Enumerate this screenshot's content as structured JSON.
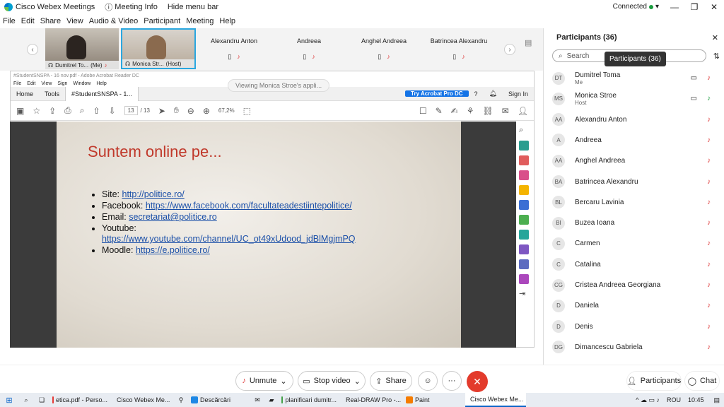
{
  "titlebar": {
    "app_title": "Cisco Webex Meetings",
    "meeting_info": "Meeting Info",
    "hide_menu": "Hide menu bar",
    "connected": "Connected"
  },
  "menu": [
    "File",
    "Edit",
    "Share",
    "View",
    "Audio & Video",
    "Participant",
    "Meeting",
    "Help"
  ],
  "video_strip": {
    "tiles": [
      {
        "name": "Dumitrel To...",
        "role": "(Me)"
      },
      {
        "name": "Monica Str...",
        "role": "(Host)"
      }
    ],
    "names": [
      "Alexandru Anton",
      "Andreea",
      "Anghel Andreea",
      "Batrincea Alexandru"
    ]
  },
  "shared": {
    "acrobat_title": "#StudentSNSPA - 16 nov.pdf - Adobe Acrobat Reader DC",
    "viewing": "Viewing Monica Stroe's appli...",
    "acrobat_menu": [
      "File",
      "Edit",
      "View",
      "Sign",
      "Window",
      "Help"
    ],
    "tabs": {
      "home": "Home",
      "tools": "Tools",
      "doc": "#StudentSNSPA - 1..."
    },
    "try_button": "Try Acrobat Pro DC",
    "sign_in": "Sign In",
    "page_current": "13",
    "page_total": "/ 13",
    "zoom": "67,2%",
    "slide": {
      "title": "Suntem online pe...",
      "items": [
        {
          "label": "Site: ",
          "link": "http://politice.ro/"
        },
        {
          "label": "Facebook: ",
          "link": "https://www.facebook.com/facultateadestiintepolitice/"
        },
        {
          "label": "Email: ",
          "link": "secretariat@politice.ro"
        },
        {
          "label": "Youtube:",
          "link": "https://www.youtube.com/channel/UC_ot49xUdood_jdBlMgjmPQ"
        },
        {
          "label": "Moodle: ",
          "link": "https://e.politice.ro/"
        }
      ]
    }
  },
  "participants": {
    "header": "Participants (36)",
    "search_placeholder": "Search",
    "tooltip": "Participants (36)",
    "list": [
      {
        "initials": "DT",
        "name": "Dumitrel Toma",
        "sub": "Me",
        "video": true,
        "mic": "off"
      },
      {
        "initials": "MS",
        "name": "Monica Stroe",
        "sub": "Host",
        "video": true,
        "mic": "on"
      },
      {
        "initials": "AA",
        "name": "Alexandru Anton",
        "sub": "",
        "mic": "off"
      },
      {
        "initials": "A",
        "name": "Andreea",
        "sub": "",
        "mic": "off"
      },
      {
        "initials": "AA",
        "name": "Anghel Andreea",
        "sub": "",
        "mic": "off"
      },
      {
        "initials": "BA",
        "name": "Batrincea Alexandru",
        "sub": "",
        "mic": "off"
      },
      {
        "initials": "BL",
        "name": "Bercaru Lavinia",
        "sub": "",
        "mic": "off"
      },
      {
        "initials": "BI",
        "name": "Buzea Ioana",
        "sub": "",
        "mic": "off"
      },
      {
        "initials": "C",
        "name": "Carmen",
        "sub": "",
        "mic": "off"
      },
      {
        "initials": "C",
        "name": "Catalina",
        "sub": "",
        "mic": "off"
      },
      {
        "initials": "CG",
        "name": "Cristea Andreea Georgiana",
        "sub": "",
        "mic": "off"
      },
      {
        "initials": "D",
        "name": "Daniela",
        "sub": "",
        "mic": "off"
      },
      {
        "initials": "D",
        "name": "Denis",
        "sub": "",
        "mic": "off"
      },
      {
        "initials": "DG",
        "name": "Dimancescu Gabriela",
        "sub": "",
        "mic": "off"
      }
    ]
  },
  "controls": {
    "unmute": "Unmute",
    "stop_video": "Stop video",
    "share": "Share",
    "participants": "Participants",
    "chat": "Chat"
  },
  "taskbar": {
    "apps": [
      "etica.pdf - Perso...",
      "Cisco Webex Me...",
      "Descărcări",
      "planificari dumitr...",
      "Real-DRAW Pro -...",
      "Paint",
      "Cisco Webex Me..."
    ],
    "lang": "ROU",
    "time": "10:45"
  }
}
